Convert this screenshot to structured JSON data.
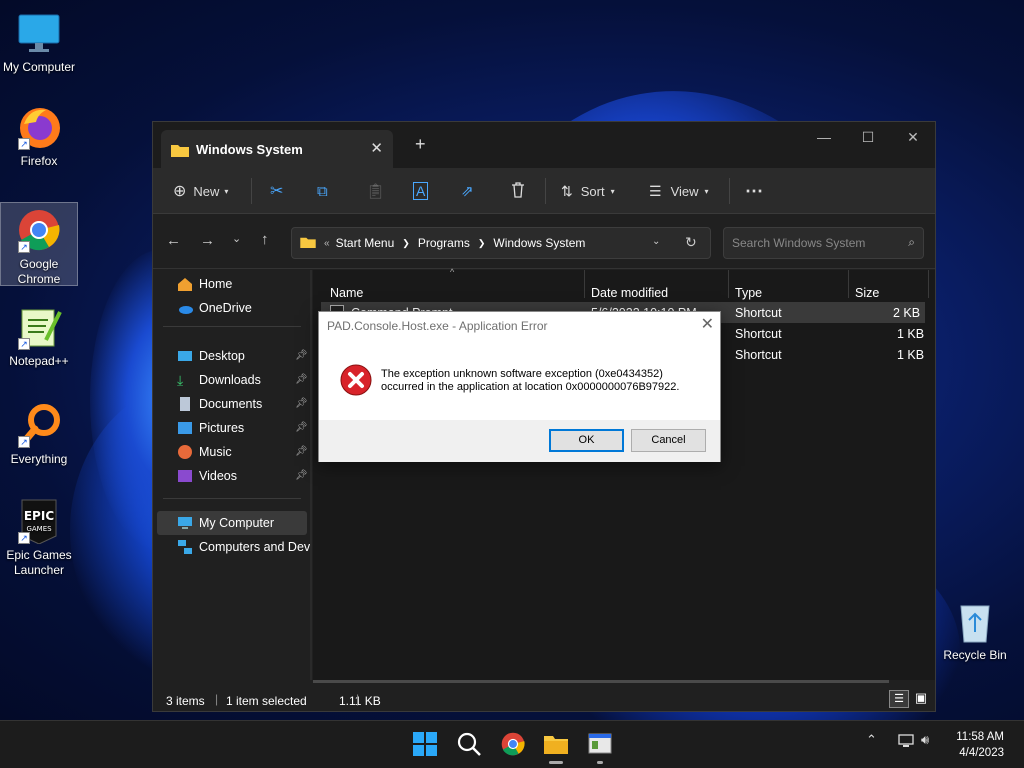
{
  "desktop": {
    "icons": [
      {
        "label": "My Computer"
      },
      {
        "label": "Firefox"
      },
      {
        "label": "Google Chrome"
      },
      {
        "label": "Notepad++"
      },
      {
        "label": "Everything"
      },
      {
        "label": "Epic Games Launcher"
      },
      {
        "label": "Recycle Bin"
      }
    ]
  },
  "explorer": {
    "tab_title": "Windows System",
    "toolbar": {
      "new": "New",
      "sort": "Sort",
      "view": "View"
    },
    "breadcrumb": [
      "Start Menu",
      "Programs",
      "Windows System"
    ],
    "search_placeholder": "Search Windows System",
    "sidebar": {
      "home": "Home",
      "onedrive": "OneDrive",
      "desktop": "Desktop",
      "downloads": "Downloads",
      "documents": "Documents",
      "pictures": "Pictures",
      "music": "Music",
      "videos": "Videos",
      "my_computer": "My Computer",
      "computers": "Computers and Devi"
    },
    "columns": {
      "name": "Name",
      "date": "Date modified",
      "type": "Type",
      "size": "Size"
    },
    "rows": [
      {
        "name": "Command Prompt",
        "date": "5/6/2022 10:10 PM",
        "type": "Shortcut",
        "size": "2 KB"
      },
      {
        "name": "",
        "date": "",
        "type": "Shortcut",
        "size": "1 KB"
      },
      {
        "name": "",
        "date": "",
        "type": "Shortcut",
        "size": "1 KB"
      }
    ],
    "status": {
      "items": "3 items",
      "selected": "1 item selected",
      "size": "1.11 KB"
    }
  },
  "dialog": {
    "title": "PAD.Console.Host.exe - Application Error",
    "line1": "The exception unknown software exception (0xe0434352)",
    "line2": "occurred in the application at location 0x0000000076B97922.",
    "ok": "OK",
    "cancel": "Cancel"
  },
  "taskbar": {
    "time": "11:58 AM",
    "date": "4/4/2023"
  }
}
